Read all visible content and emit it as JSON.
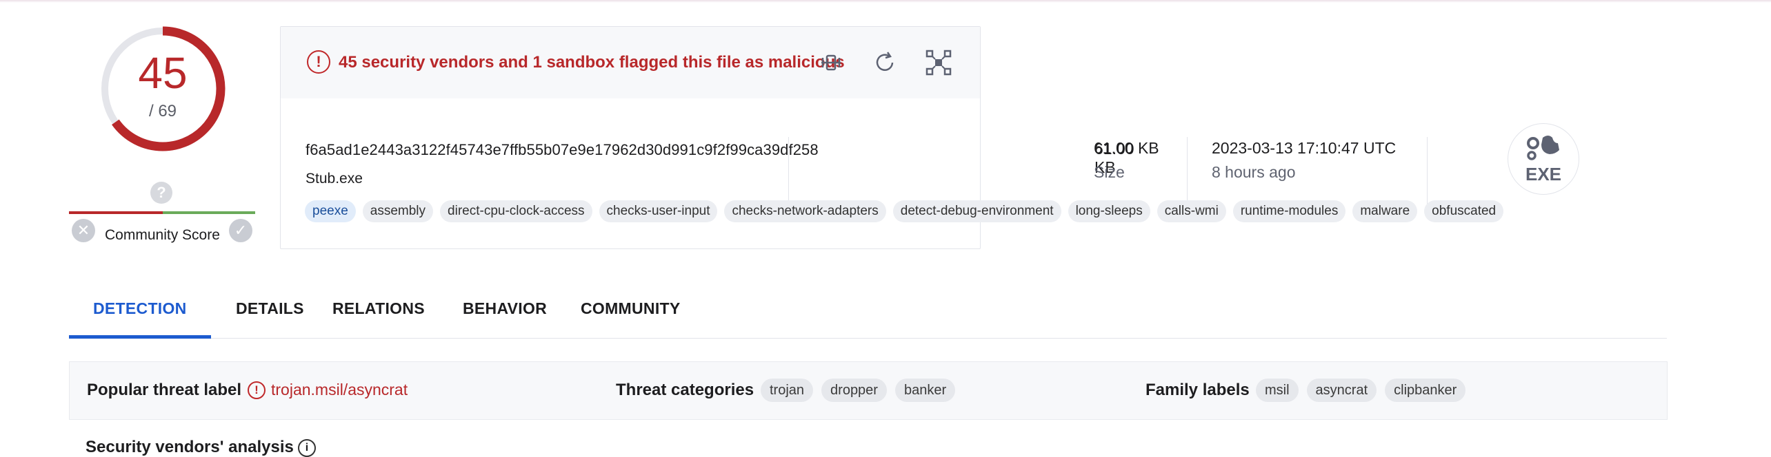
{
  "score": {
    "detected": "45",
    "total": "/ 69",
    "fraction": 0.652
  },
  "community": {
    "label": "Community Score",
    "unknown_icon": "question-icon",
    "down_icon": "x-icon",
    "up_icon": "check-icon"
  },
  "alert": {
    "text": "45 security vendors and 1 sandbox flagged this file as malicious"
  },
  "toolbar": {
    "icons": [
      "compare-icon",
      "reanalyze-icon",
      "graph-icon"
    ]
  },
  "file": {
    "hash": "f6a5ad1e2443a3122f45743e7ffb55b07e9e17962d30d991c9f2f99ca39df258",
    "name": "Stub.exe",
    "size_value": "61.00 KB",
    "size_label": "Size",
    "date_value": "2023-03-13 17:10:47 UTC",
    "date_ago": "8 hours ago",
    "type_badge": "EXE"
  },
  "tags": [
    "peexe",
    "assembly",
    "direct-cpu-clock-access",
    "checks-user-input",
    "checks-network-adapters",
    "detect-debug-environment",
    "long-sleeps",
    "calls-wmi",
    "runtime-modules",
    "malware",
    "obfuscated"
  ],
  "tabs": [
    "DETECTION",
    "DETAILS",
    "RELATIONS",
    "BEHAVIOR",
    "COMMUNITY"
  ],
  "threat": {
    "popular_label": "Popular threat label",
    "popular_value": "trojan.msil/asyncrat",
    "categories_label": "Threat categories",
    "categories": [
      "trojan",
      "dropper",
      "banker"
    ],
    "family_label": "Family labels",
    "families": [
      "msil",
      "asyncrat",
      "clipbanker"
    ]
  },
  "section_title": "Security vendors' analysis",
  "colors": {
    "malicious": "#b8282a",
    "accent": "#1d5bcf",
    "harmless": "#6aab5a"
  }
}
